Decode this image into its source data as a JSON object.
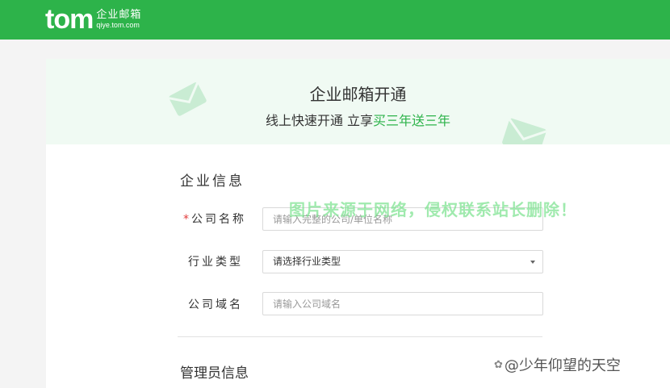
{
  "header": {
    "logo_word": "tom",
    "logo_cn": "企业邮箱",
    "logo_url": "qiye.tom.com"
  },
  "hero": {
    "title": "企业邮箱开通",
    "subtitle_prefix": "线上快速开通 立享",
    "subtitle_highlight": "买三年送三年"
  },
  "form": {
    "section_company": "企业信息",
    "required_mark": "*",
    "company_name_label": "公司名称",
    "company_name_placeholder": "请输入完整的公司/单位名称",
    "industry_label": "行业类型",
    "industry_value": "请选择行业类型",
    "domain_label": "公司域名",
    "domain_placeholder": "请输入公司域名",
    "section_admin": "管理员信息"
  },
  "overlay": {
    "watermark": "图片来源于网络，侵权联系站长删除！",
    "credit": "@少年仰望的天空"
  },
  "colors": {
    "brand_green": "#2db34a",
    "hero_bg": "#f0faf3",
    "required_red": "#e23b3b"
  },
  "icons": [
    "envelope-icon",
    "chevron-down-icon",
    "toutiao-icon"
  ]
}
